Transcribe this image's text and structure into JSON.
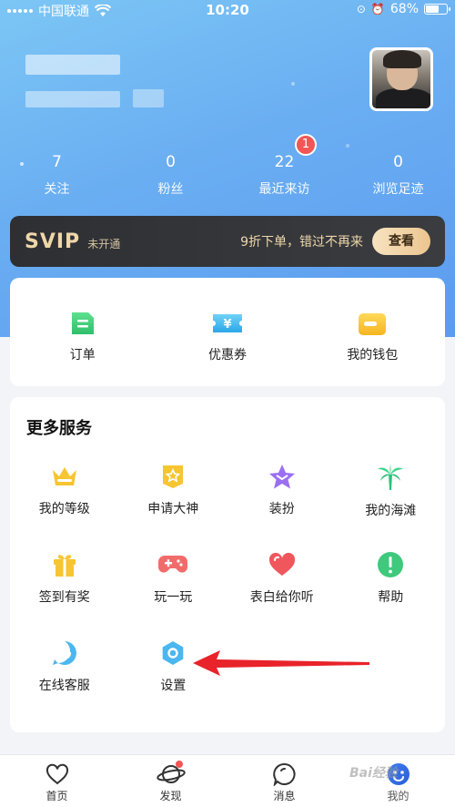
{
  "status_bar": {
    "carrier": "中国联通",
    "time": "10:20",
    "battery": "68%",
    "battery_level": 0.68
  },
  "stats": [
    {
      "value": "7",
      "label": "关注"
    },
    {
      "value": "0",
      "label": "粉丝"
    },
    {
      "value": "22",
      "label": "最近来访",
      "badge": "1"
    },
    {
      "value": "0",
      "label": "浏览足迹"
    }
  ],
  "svip": {
    "title": "SVIP",
    "status": "未开通",
    "promo": "9折下单，错过不再来",
    "button": "查看"
  },
  "quick": [
    {
      "label": "订单",
      "icon": "order-icon",
      "color": "#3fcf7a"
    },
    {
      "label": "优惠券",
      "icon": "coupon-icon",
      "color": "#44b8ee"
    },
    {
      "label": "我的钱包",
      "icon": "wallet-icon",
      "color": "#f8c83a"
    }
  ],
  "services": {
    "title": "更多服务",
    "items": [
      {
        "label": "我的等级",
        "icon": "crown-icon"
      },
      {
        "label": "申请大神",
        "icon": "star-badge-icon"
      },
      {
        "label": "装扮",
        "icon": "dress-up-star-icon"
      },
      {
        "label": "我的海滩",
        "icon": "palm-tree-icon"
      },
      {
        "label": "签到有奖",
        "icon": "gift-icon"
      },
      {
        "label": "玩一玩",
        "icon": "gamepad-icon"
      },
      {
        "label": "表白给你听",
        "icon": "heart-icon"
      },
      {
        "label": "帮助",
        "icon": "help-icon"
      },
      {
        "label": "在线客服",
        "icon": "customer-service-icon"
      },
      {
        "label": "设置",
        "icon": "settings-hexagon-icon"
      }
    ]
  },
  "tabs": [
    {
      "label": "首页",
      "icon": "home-heart-icon"
    },
    {
      "label": "发现",
      "icon": "planet-icon",
      "dot": true
    },
    {
      "label": "消息",
      "icon": "message-icon"
    },
    {
      "label": "我的",
      "icon": "profile-face-icon",
      "active": true
    }
  ],
  "watermark": "Bai经验"
}
